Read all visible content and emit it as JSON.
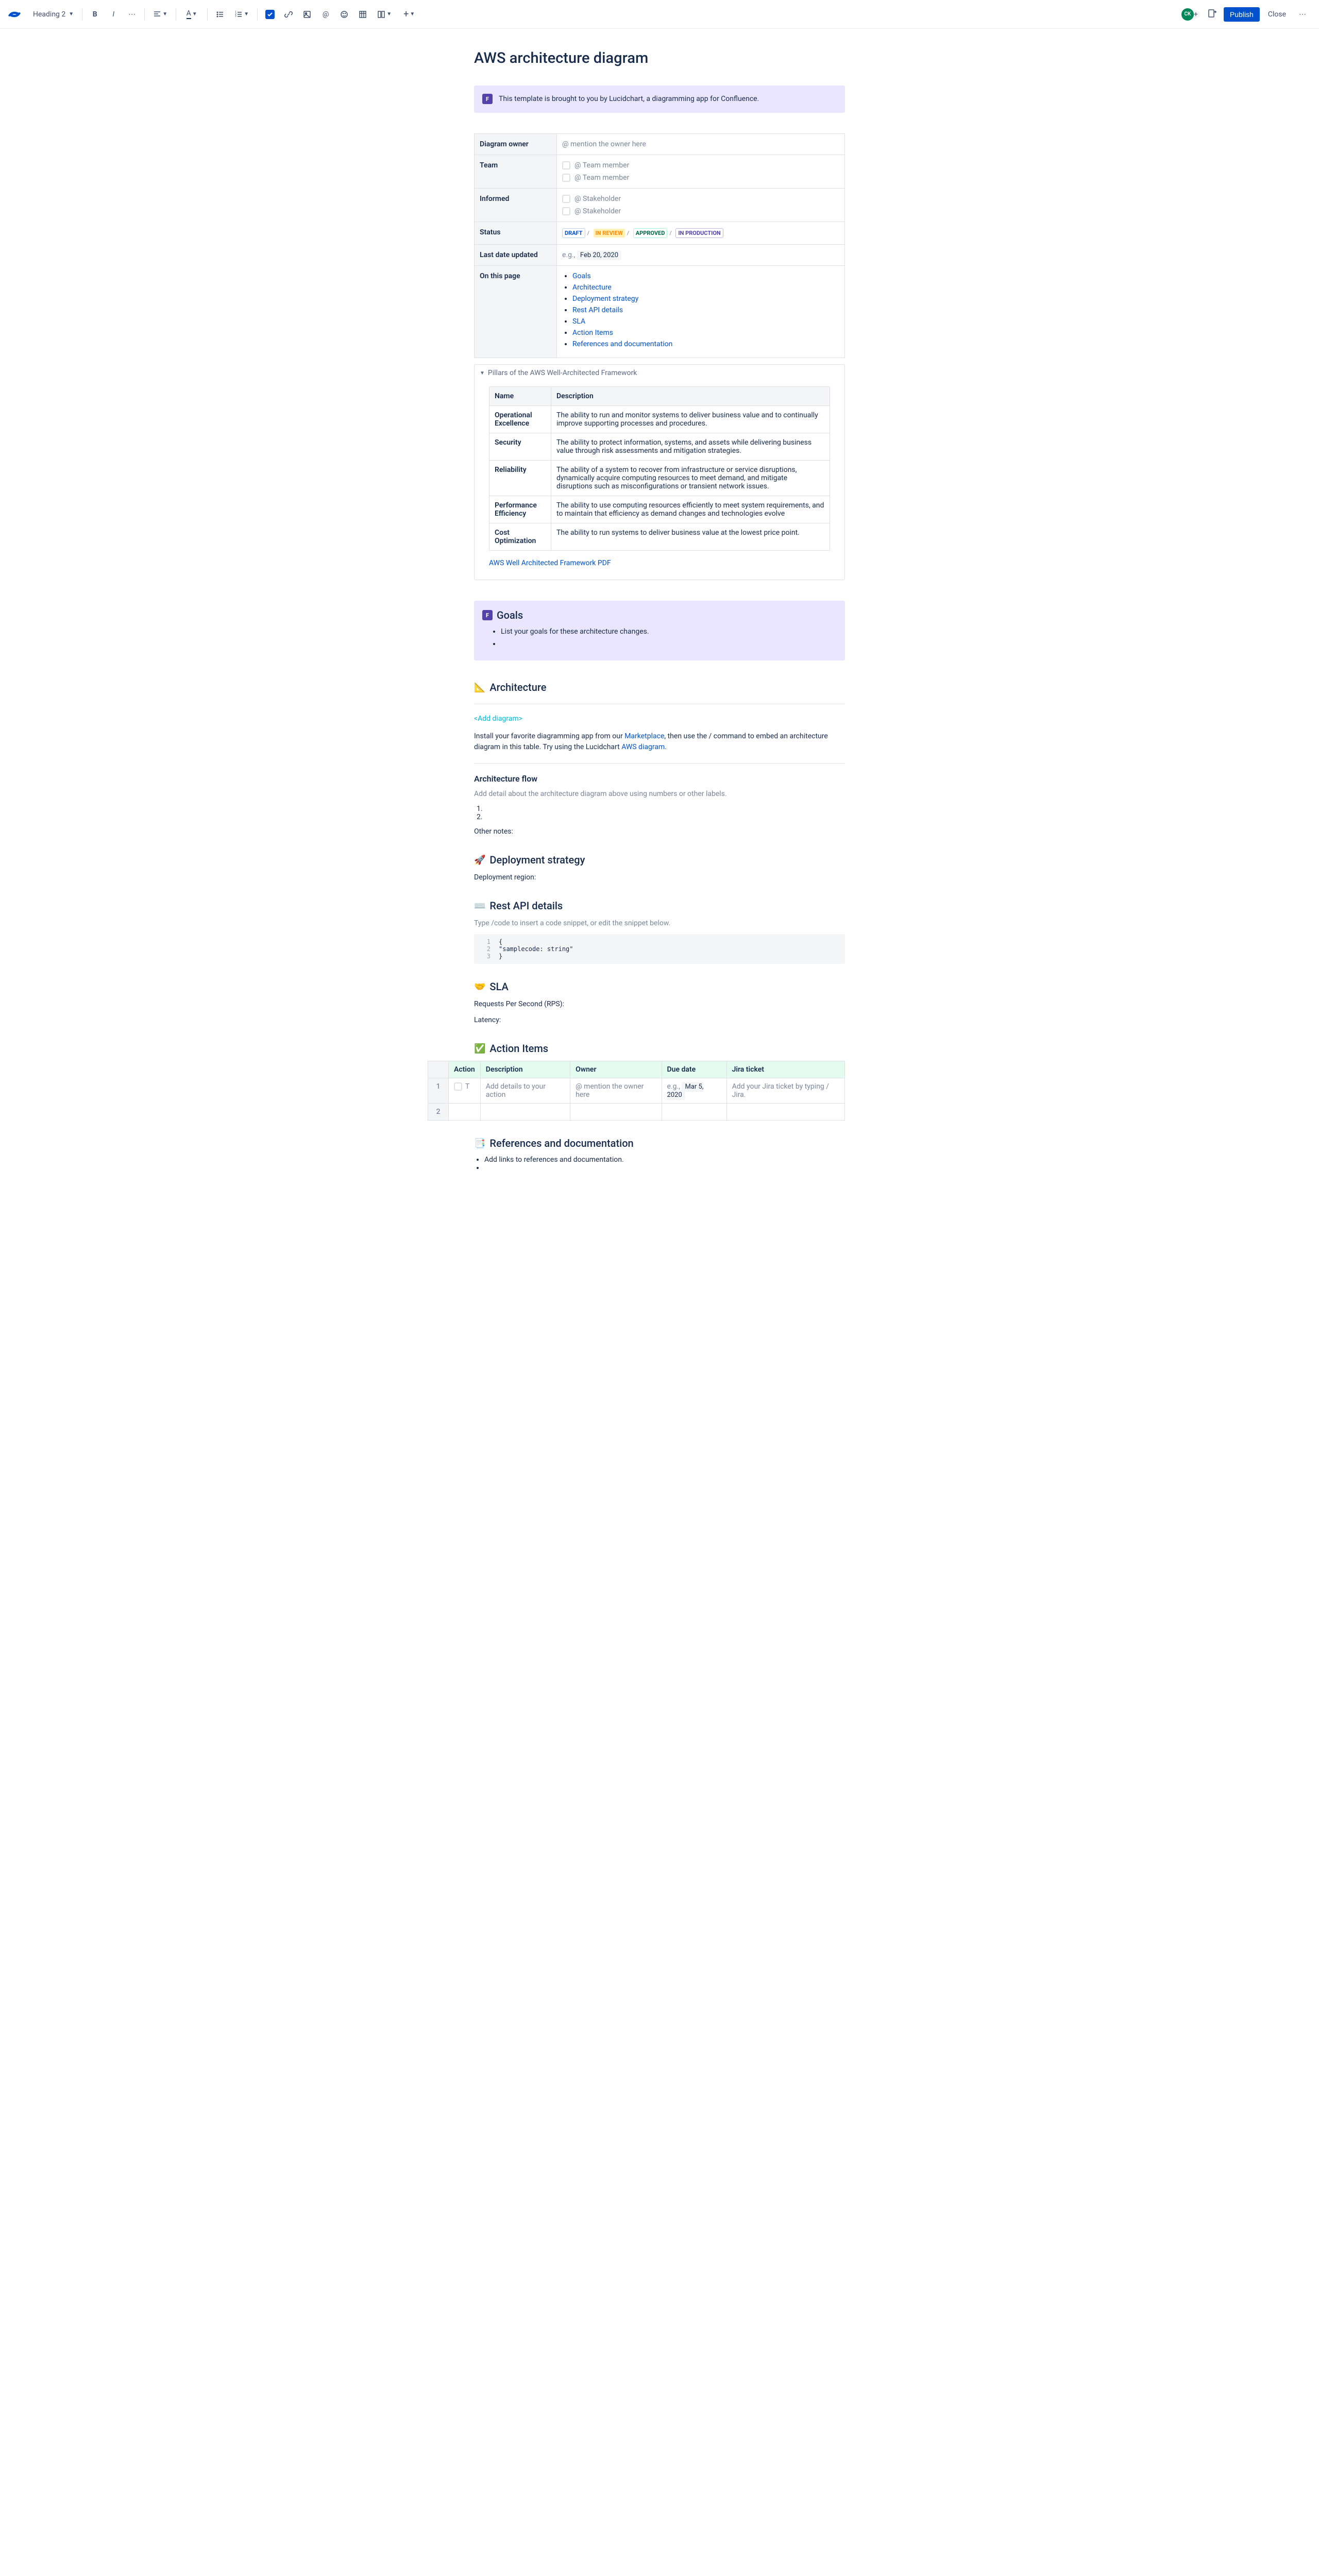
{
  "toolbar": {
    "textStyle": "Heading 2",
    "publish": "Publish",
    "close": "Close",
    "avatar": "CK"
  },
  "page": {
    "title": "AWS architecture diagram",
    "intro": "This template is brought to you by Lucidchart, a diagramming app for Confluence."
  },
  "meta": {
    "ownerLabel": "Diagram owner",
    "ownerPlaceholder": "@ mention the owner here",
    "teamLabel": "Team",
    "teamItem": "@ Team member",
    "informedLabel": "Informed",
    "informedItem": "@ Stakeholder",
    "statusLabel": "Status",
    "statusDraft": "DRAFT",
    "statusReview": "IN REVIEW",
    "statusApproved": "APPROVED",
    "statusProd": "IN PRODUCTION",
    "lastDateLabel": "Last date updated",
    "lastDateEg": "e.g.,",
    "lastDateValue": "Feb 20, 2020",
    "onPageLabel": "On this page",
    "links": {
      "goals": "Goals",
      "architecture": "Architecture",
      "deployment": "Deployment strategy",
      "restapi": "Rest API details",
      "sla": "SLA",
      "actions": "Action Items",
      "refs": "References and documentation"
    }
  },
  "expand": {
    "title": "Pillars of the AWS Well-Architected Framework",
    "colName": "Name",
    "colDesc": "Description",
    "rows": [
      {
        "name": "Operational Excellence",
        "desc": "The ability to run and monitor systems to deliver business value and to continually improve supporting processes and procedures."
      },
      {
        "name": "Security",
        "desc": "The ability to protect information, systems, and assets while delivering business value through risk assessments and mitigation strategies."
      },
      {
        "name": "Reliability",
        "desc": "The ability of a system to recover from infrastructure or service disruptions, dynamically acquire computing resources to meet demand, and mitigate disruptions such as misconfigurations or transient network issues."
      },
      {
        "name": "Performance Efficiency",
        "desc": "The ability to use computing resources efficiently to meet system requirements, and to maintain that efficiency as demand changes and technologies evolve"
      },
      {
        "name": "Cost Optimization",
        "desc": "The ability to run systems to deliver business value at the lowest price point."
      }
    ],
    "pdf": "AWS Well Architected Framework PDF"
  },
  "goals": {
    "heading": "Goals",
    "item": "List your goals for these architecture changes."
  },
  "architecture": {
    "heading": "Architecture",
    "addDiagram": "<Add diagram>",
    "desc1": "Install your favorite diagramming app from our ",
    "marketplace": "Marketplace",
    "desc2": ", then use the / command to embed an architecture diagram in this table. Try using the Lucidchart ",
    "awsdiagram": "AWS diagram",
    "desc3": ".",
    "flowHeading": "Architecture flow",
    "flowDesc": "Add detail about the architecture diagram above using numbers or other labels.",
    "otherNotes": "Other notes:"
  },
  "deployment": {
    "heading": "Deployment strategy",
    "region": "Deployment region:"
  },
  "restapi": {
    "heading": "Rest API details",
    "desc": "Type /code to insert a code snippet, or edit the snippet below.",
    "code": {
      "l1": "{",
      "l2": "    \"samplecode: string\"",
      "l3": "}"
    }
  },
  "sla": {
    "heading": "SLA",
    "rps": "Requests Per Second (RPS):",
    "latency": "Latency:"
  },
  "actions": {
    "heading": "Action Items",
    "cols": {
      "action": "Action",
      "desc": "Description",
      "owner": "Owner",
      "due": "Due date",
      "jira": "Jira ticket"
    },
    "row1": {
      "desc": "Add details to your action",
      "owner": "@ mention the owner here",
      "dueEg": "e.g.,",
      "dueDate": "Mar 5, 2020",
      "jira": "Add your Jira ticket by typing / Jira."
    }
  },
  "refs": {
    "heading": "References and documentation",
    "item": "Add links to references and documentation."
  }
}
